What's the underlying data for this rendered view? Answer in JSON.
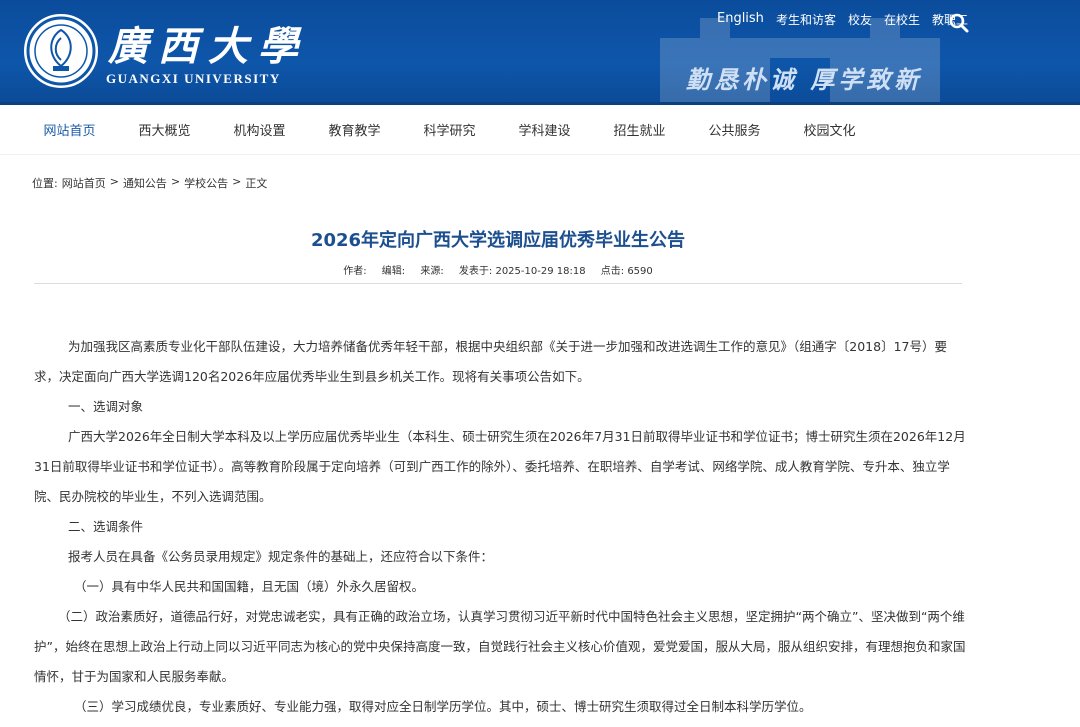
{
  "header": {
    "brand_cn": "廣西大學",
    "brand_en": "GUANGXI UNIVERSITY",
    "motto": "勤恳朴诚 厚学致新",
    "toplinks": [
      "English",
      "考生和访客",
      "校友",
      "在校生",
      "教职工"
    ]
  },
  "nav": [
    "网站首页",
    "西大概览",
    "机构设置",
    "教育教学",
    "科学研究",
    "学科建设",
    "招生就业",
    "公共服务",
    "校园文化"
  ],
  "breadcrumb": {
    "label": "位置:",
    "items": [
      "网站首页",
      "通知公告",
      "学校公告",
      "正文"
    ]
  },
  "article": {
    "title": "2026年定向广西大学选调应届优秀毕业生公告",
    "meta": {
      "author": "作者:",
      "editor": "编辑:",
      "source": "来源:",
      "published": "发表于:  2025-10-29 18:18",
      "views": "点击:  6590"
    },
    "paragraphs": [
      "为加强我区高素质专业化干部队伍建设，大力培养储备优秀年轻干部，根据中央组织部《关于进一步加强和改进选调生工作的意见》（组通字〔2018〕17号）要求，决定面向广西大学选调120名2026年应届优秀毕业生到县乡机关工作。现将有关事项公告如下。",
      "一、选调对象",
      "广西大学2026年全日制大学本科及以上学历应届优秀毕业生（本科生、硕士研究生须在2026年7月31日前取得毕业证书和学位证书；博士研究生须在2026年12月31日前取得毕业证书和学位证书）。高等教育阶段属于定向培养（可到广西工作的除外）、委托培养、在职培养、自学考试、网络学院、成人教育学院、专升本、独立学院、民办院校的毕业生，不列入选调范围。",
      "二、选调条件",
      "报考人员在具备《公务员录用规定》规定条件的基础上，还应符合以下条件：",
      "（一）具有中华人民共和国国籍，且无国（境）外永久居留权。",
      "（二）政治素质好，道德品行好，对党忠诚老实，具有正确的政治立场，认真学习贯彻习近平新时代中国特色社会主义思想，坚定拥护“两个确立”、坚决做到“两个维护”，始终在思想上政治上行动上同以习近平同志为核心的党中央保持高度一致，自觉践行社会主义核心价值观，爱党爱国，服从大局，服从组织安排，有理想抱负和家国情怀，甘于为国家和人民服务奉献。",
      "（三）学习成绩优良，专业素质好、专业能力强，取得对应全日制学历学位。其中，硕士、博士研究生须取得过全日制本科学历学位。"
    ]
  },
  "colors": {
    "header_blue": "#0e56aa",
    "title_blue": "#1c4f8f",
    "nav_active": "#1a5aa8"
  }
}
